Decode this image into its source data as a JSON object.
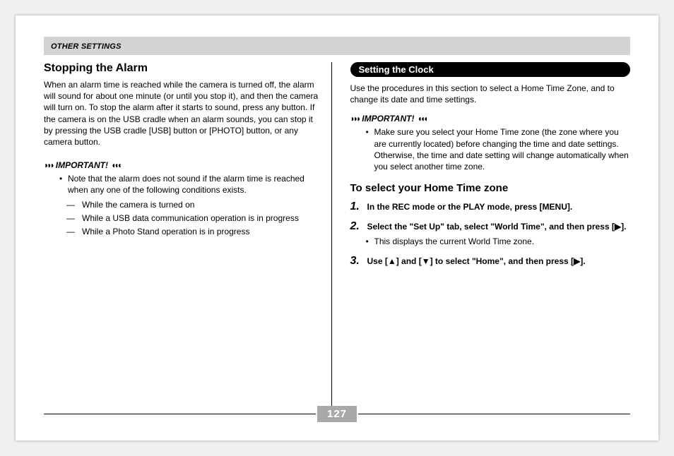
{
  "header": {
    "breadcrumb": "OTHER SETTINGS"
  },
  "left": {
    "title": "Stopping the Alarm",
    "para": "When an alarm time is reached while the camera is turned off, the alarm will sound for about one minute (or until you stop it), and then the camera will turn on. To stop the alarm after it starts to sound, press any button. If the camera is on the USB cradle when an alarm sounds, you can stop it by pressing the USB cradle [USB] button or [PHOTO] button, or any camera button.",
    "important_label": "IMPORTANT!",
    "bullet": "Note that the alarm does not sound if the alarm time is reached when any one of the following conditions exists.",
    "dashes": [
      "While the camera is turned on",
      "While a USB data communication operation is in progress",
      "While a Photo Stand operation is in progress"
    ]
  },
  "right": {
    "pill": "Setting the Clock",
    "intro": "Use the procedures in this section to select a Home Time Zone, and to change its date and time settings.",
    "important_label": "IMPORTANT!",
    "bullet": "Make sure you select your Home Time zone (the zone where you are currently located) before changing the time and date settings. Otherwise, the time and date setting will change automatically when you select another time zone.",
    "subtitle": "To select your Home Time zone",
    "steps": [
      {
        "num": "1.",
        "text": "In the REC mode or the PLAY mode, press [MENU]."
      },
      {
        "num": "2.",
        "text": "Select the \"Set Up\" tab, select \"World Time\", and then press [▶].",
        "note": "This displays the current World Time zone."
      },
      {
        "num": "3.",
        "text": "Use [▲] and [▼] to select \"Home\", and then press [▶]."
      }
    ]
  },
  "page_number": "127"
}
